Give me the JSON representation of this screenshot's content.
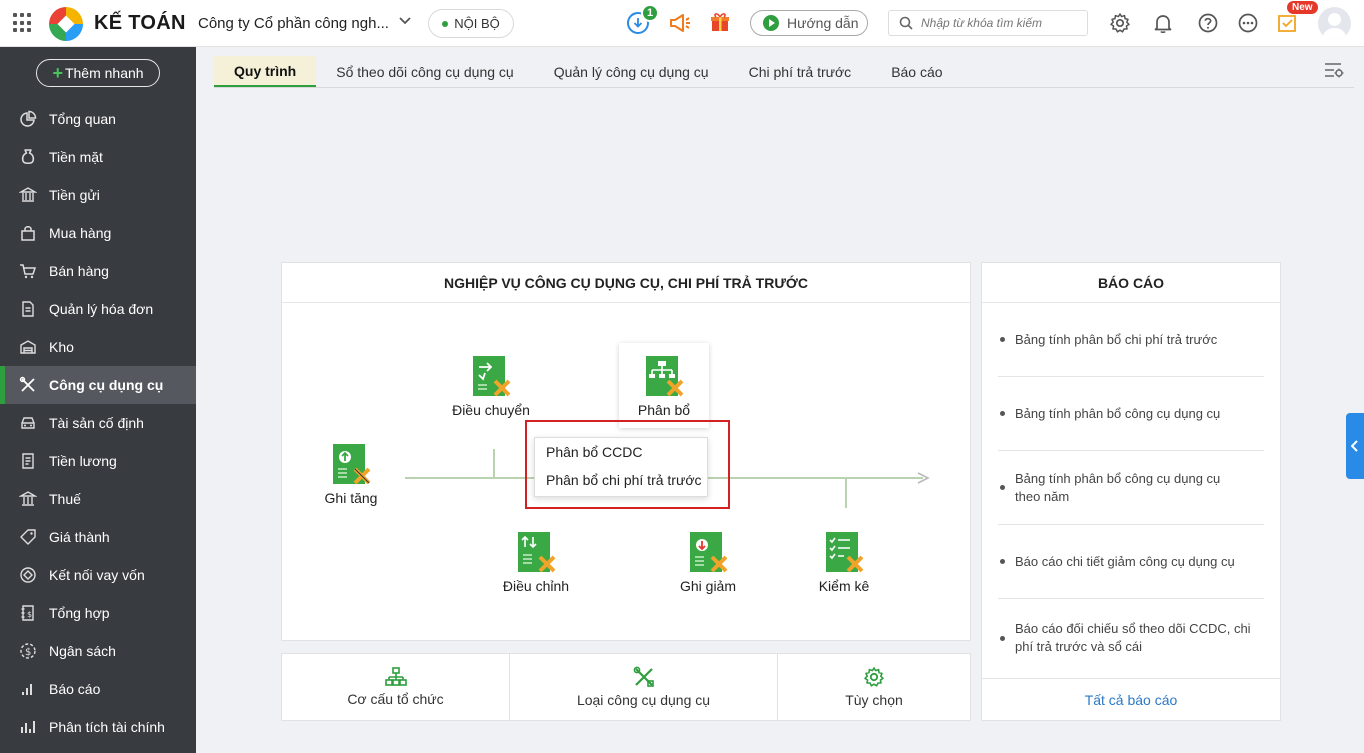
{
  "header": {
    "brand": "KẾ TOÁN",
    "company": "Công ty Cổ phần công ngh...",
    "scope": "NỘI BỘ",
    "download_count": "1",
    "guide_label": "Hướng dẫn",
    "search_placeholder": "Nhập từ khóa tìm kiếm",
    "new_badge": "New"
  },
  "sidebar": {
    "quick_add": "Thêm nhanh",
    "items": [
      {
        "label": "Tổng quan"
      },
      {
        "label": "Tiền mặt"
      },
      {
        "label": "Tiền gửi"
      },
      {
        "label": "Mua hàng"
      },
      {
        "label": "Bán hàng"
      },
      {
        "label": "Quản lý hóa đơn"
      },
      {
        "label": "Kho"
      },
      {
        "label": "Công cụ dụng cụ"
      },
      {
        "label": "Tài sản cố định"
      },
      {
        "label": "Tiền lương"
      },
      {
        "label": "Thuế"
      },
      {
        "label": "Giá thành"
      },
      {
        "label": "Kết nối vay vốn"
      },
      {
        "label": "Tổng hợp"
      },
      {
        "label": "Ngân sách"
      },
      {
        "label": "Báo cáo"
      },
      {
        "label": "Phân tích tài chính"
      }
    ]
  },
  "tabs": [
    {
      "label": "Quy trình"
    },
    {
      "label": "Sổ theo dõi công cụ dụng cụ"
    },
    {
      "label": "Quản lý công cụ dụng cụ"
    },
    {
      "label": "Chi phí trả trước"
    },
    {
      "label": "Báo cáo"
    }
  ],
  "process": {
    "title": "NGHIỆP VỤ CÔNG CỤ DỤNG CỤ, CHI PHÍ TRẢ TRƯỚC",
    "nodes": {
      "increase": "Ghi tăng",
      "transfer": "Điều chuyển",
      "allocate": "Phân bổ",
      "adjust": "Điều chỉnh",
      "decrease": "Ghi giảm",
      "inventory": "Kiểm kê"
    },
    "popup": {
      "item1": "Phân bổ CCDC",
      "item2": "Phân bổ chi phí trả trước"
    }
  },
  "reports": {
    "title": "BÁO CÁO",
    "items": [
      "Bảng tính phân bổ chi phí trả trước",
      "Bảng tính phân bổ công cụ dụng cụ",
      "Bảng tính phân bổ công cụ dụng cụ theo năm",
      "Báo cáo chi tiết giảm công cụ dụng cụ",
      "Báo cáo đối chiếu sổ theo dõi CCDC, chi phí trả trước và sổ cái"
    ],
    "all": "Tất cả báo cáo"
  },
  "bottom": {
    "org": "Cơ cấu tổ chức",
    "tool_type": "Loại công cụ dụng cụ",
    "options": "Tùy chọn"
  },
  "colors": {
    "accent_green": "#2e9e3e",
    "sidebar_bg": "#383b40",
    "link_blue": "#2a78c8",
    "highlight_red": "#d32020"
  }
}
